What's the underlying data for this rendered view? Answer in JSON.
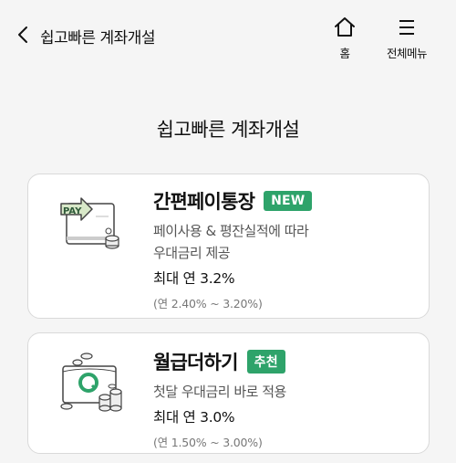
{
  "header": {
    "title": "쉽고빠른 계좌개설",
    "home_label": "홈",
    "menu_label": "전체메뉴"
  },
  "page_title": "쉽고빠른 계좌개설",
  "cards": [
    {
      "title": "간편페이통장",
      "badge": "NEW",
      "desc_line1": "페이사용 & 평잔실적에 따라",
      "desc_line2": "우대금리 제공",
      "rate": "최대 연 3.2%",
      "range": "(연 2.40% ~ 3.20%)",
      "illustration_text": "PAY"
    },
    {
      "title": "월급더하기",
      "badge": "추천",
      "desc_line1": "첫달 우대금리 바로 적용",
      "rate": "최대 연 3.0%",
      "range": "(연 1.50% ~ 3.00%)"
    }
  ],
  "colors": {
    "badge_green": "#2ea36a",
    "background": "#f5f5f5",
    "card_border": "#d9d9d9"
  }
}
